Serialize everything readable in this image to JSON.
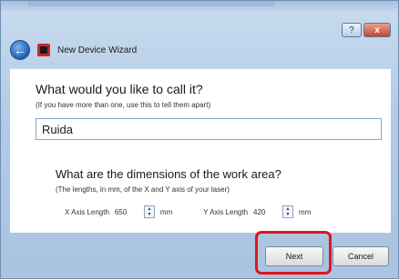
{
  "window": {
    "controls": {
      "help_glyph": "?",
      "close_glyph": "x"
    }
  },
  "header": {
    "back_icon": "back-arrow-icon",
    "app_icon": "app-icon",
    "title": "New Device Wizard"
  },
  "name_section": {
    "question": "What would you like to call it?",
    "hint": "(If you have more than one, use this to tell them apart)",
    "value": "Ruida"
  },
  "dimensions_section": {
    "question": "What are the dimensions of the work area?",
    "hint": "(The lengths, in mm, of the X and Y axis of your laser)",
    "x_label": "X Axis Length",
    "x_value": "650",
    "x_unit": "mm",
    "y_label": "Y Axis Length",
    "y_value": "420",
    "y_unit": "mm"
  },
  "footer": {
    "next_label": "Next",
    "cancel_label": "Cancel"
  },
  "colors": {
    "highlight": "#e0151b",
    "accent": "#1e5fb5"
  }
}
